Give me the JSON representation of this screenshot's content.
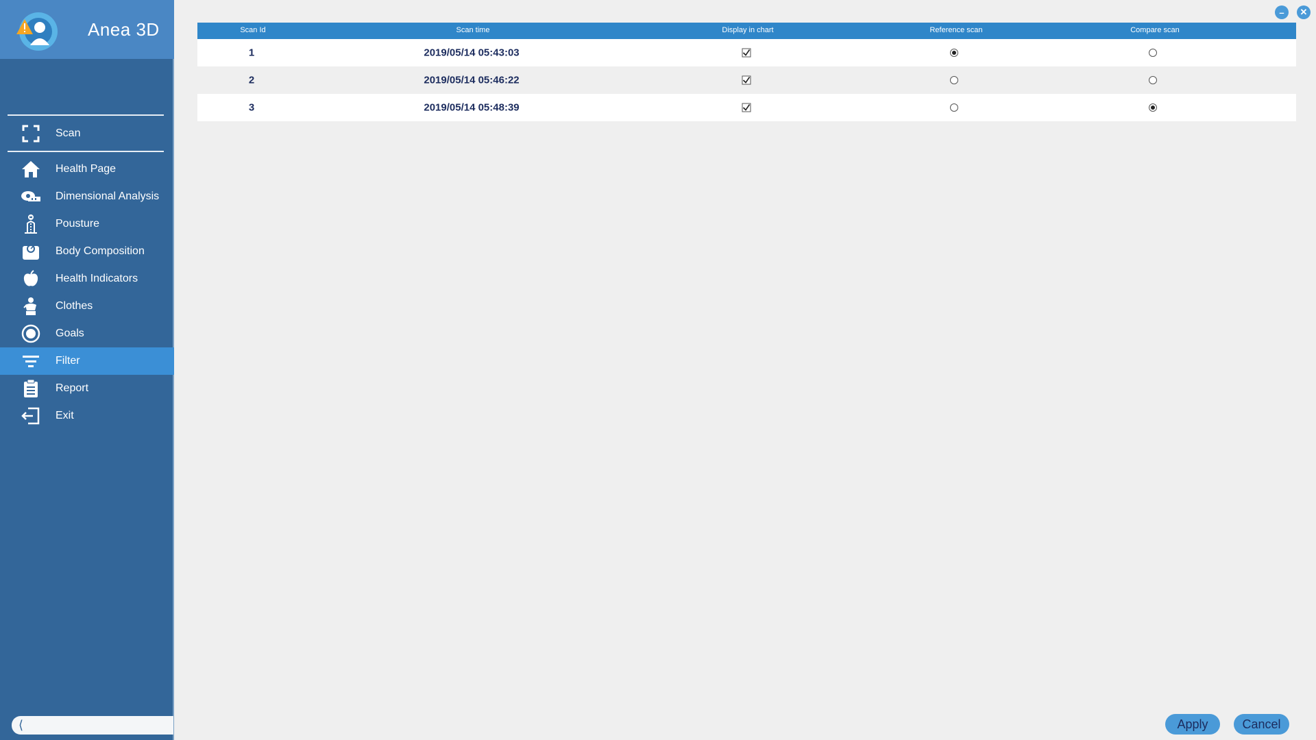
{
  "app": {
    "title": "Anea 3D"
  },
  "sidebar": {
    "scan": {
      "label": "Scan",
      "icon": "scan-frame-icon"
    },
    "items": [
      {
        "label": "Health Page",
        "icon": "home-icon"
      },
      {
        "label": "Dimensional Analysis",
        "icon": "measuring-tape-icon"
      },
      {
        "label": "Pousture",
        "icon": "posture-icon"
      },
      {
        "label": "Body Composition",
        "icon": "scale-icon"
      },
      {
        "label": "Health Indicators",
        "icon": "apple-icon"
      },
      {
        "label": "Clothes",
        "icon": "clothes-icon"
      },
      {
        "label": "Goals",
        "icon": "target-icon"
      },
      {
        "label": "Filter",
        "icon": "filter-icon",
        "active": true
      },
      {
        "label": "Report",
        "icon": "clipboard-icon"
      },
      {
        "label": "Exit",
        "icon": "exit-icon"
      }
    ],
    "accent": "#3b8fd6",
    "background": "#336699"
  },
  "table": {
    "headers": [
      "Scan Id",
      "Scan time",
      "Display in chart",
      "Reference scan",
      "Compare scan"
    ],
    "rows": [
      {
        "scan_id": "1",
        "scan_time": "2019/05/14 05:43:03",
        "display_in_chart": true,
        "reference_scan": true,
        "compare_scan": false
      },
      {
        "scan_id": "2",
        "scan_time": "2019/05/14 05:46:22",
        "display_in_chart": true,
        "reference_scan": false,
        "compare_scan": false
      },
      {
        "scan_id": "3",
        "scan_time": "2019/05/14 05:48:39",
        "display_in_chart": true,
        "reference_scan": false,
        "compare_scan": true
      }
    ],
    "header_color": "#2f86c9"
  },
  "buttons": {
    "apply": "Apply",
    "cancel": "Cancel"
  }
}
